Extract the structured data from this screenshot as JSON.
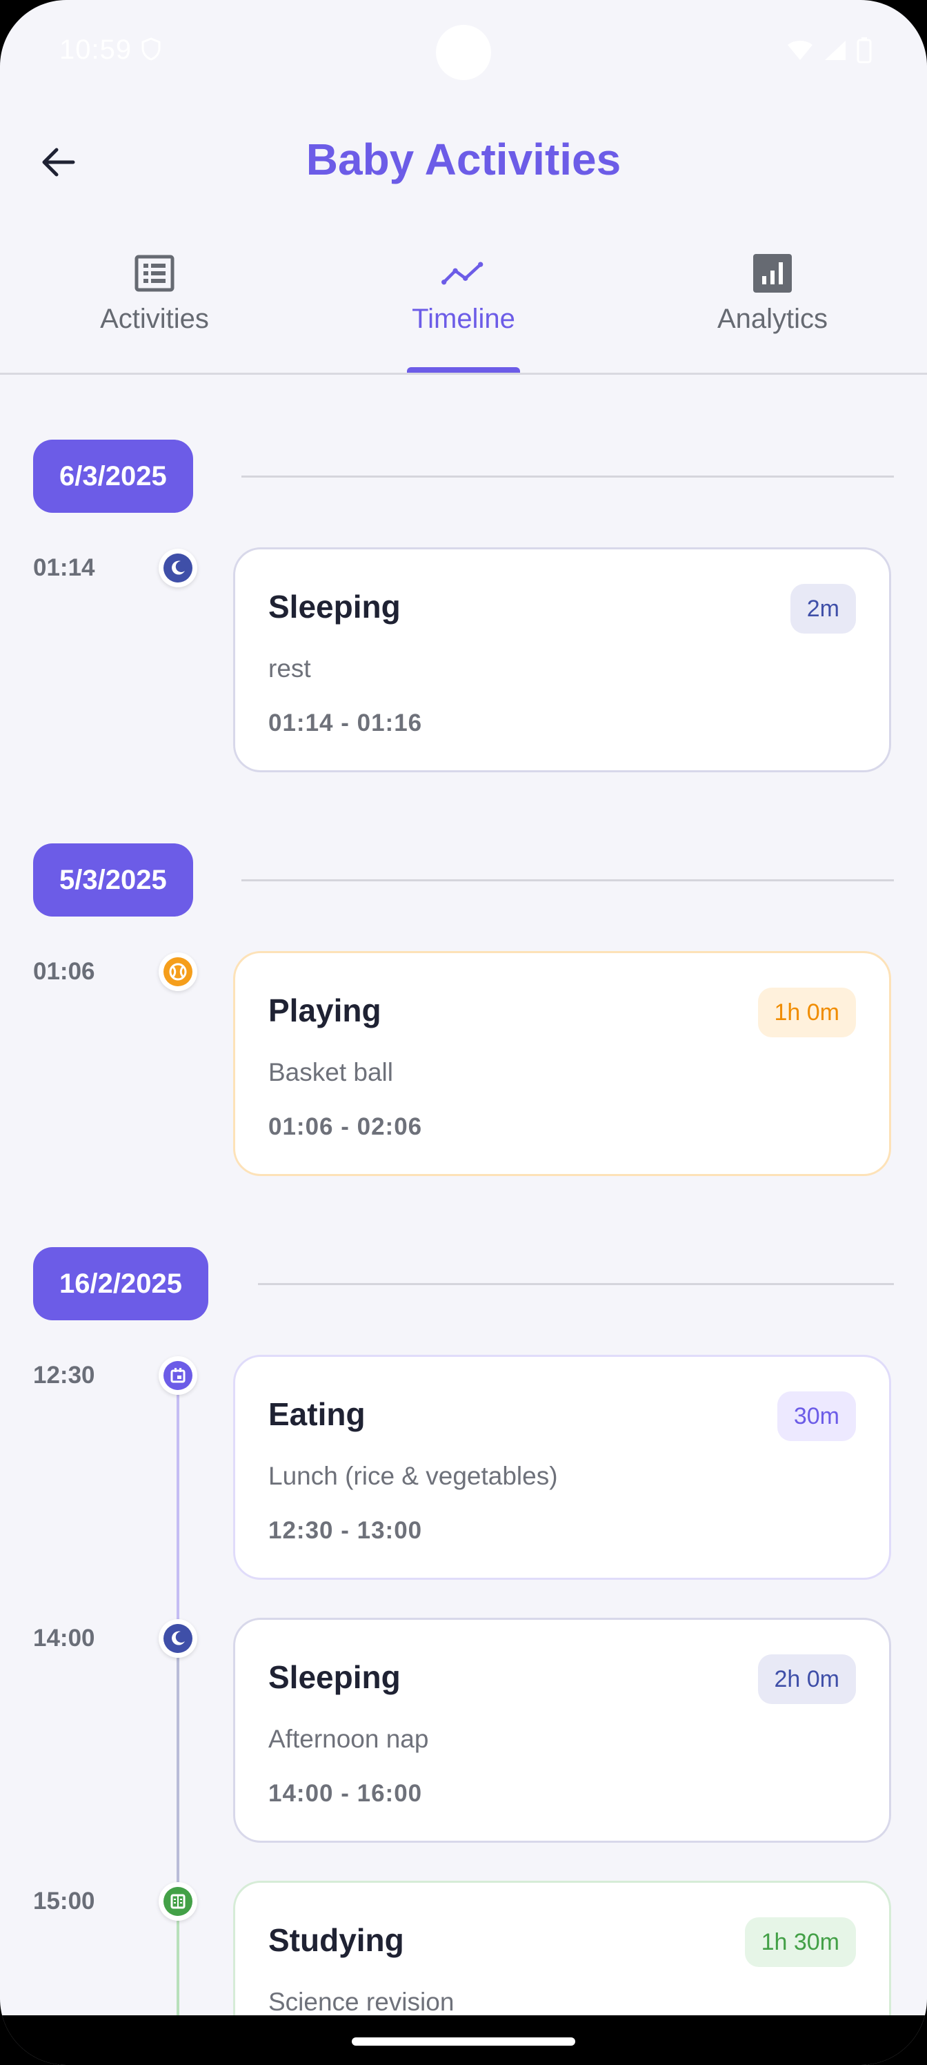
{
  "status_bar": {
    "time": "10:59"
  },
  "app_bar": {
    "title": "Baby Activities"
  },
  "tabs": [
    {
      "label": "Activities",
      "icon": "list-icon",
      "active": false
    },
    {
      "label": "Timeline",
      "icon": "timeline-icon",
      "active": true
    },
    {
      "label": "Analytics",
      "icon": "bar-chart-icon",
      "active": false
    }
  ],
  "colors": {
    "accent": "#6c5ce7",
    "sleeping": "#3f4fa8",
    "playing": "#f59e1b",
    "eating": "#6c5ce7",
    "studying": "#43a047"
  },
  "groups": [
    {
      "date": "6/3/2025",
      "entries": [
        {
          "time": "01:14",
          "title": "Sleeping",
          "duration": "2m",
          "note": "rest",
          "range": "01:14 - 01:16",
          "icon": "moon-icon"
        }
      ]
    },
    {
      "date": "5/3/2025",
      "entries": [
        {
          "time": "01:06",
          "title": "Playing",
          "duration": "1h 0m",
          "note": "Basket ball",
          "range": "01:06 - 02:06",
          "icon": "ball-icon"
        }
      ]
    },
    {
      "date": "16/2/2025",
      "entries": [
        {
          "time": "12:30",
          "title": "Eating",
          "duration": "30m",
          "note": "Lunch (rice & vegetables)",
          "range": "12:30 - 13:00",
          "icon": "meal-icon"
        },
        {
          "time": "14:00",
          "title": "Sleeping",
          "duration": "2h 0m",
          "note": "Afternoon nap",
          "range": "14:00 - 16:00",
          "icon": "moon-icon"
        },
        {
          "time": "15:00",
          "title": "Studying",
          "duration": "1h 30m",
          "note": "Science revision",
          "range": "",
          "icon": "book-icon"
        }
      ]
    }
  ]
}
